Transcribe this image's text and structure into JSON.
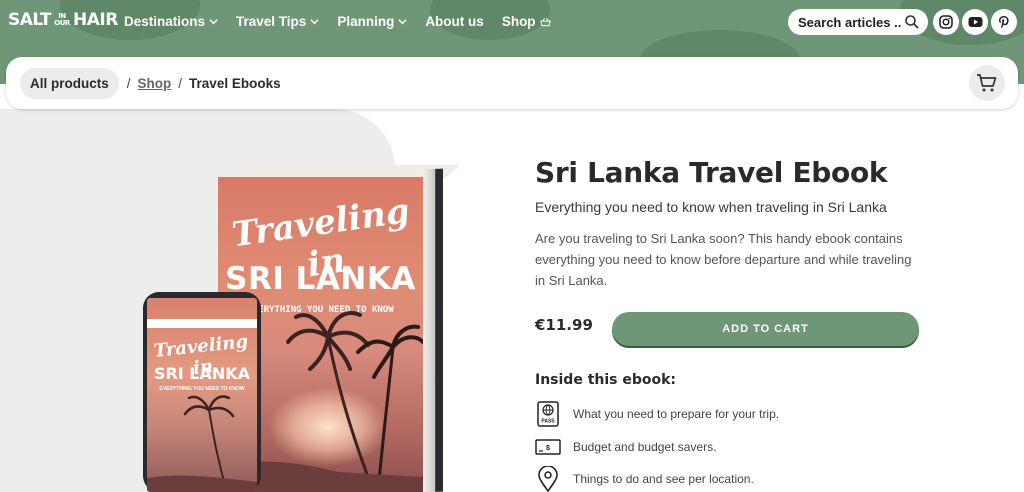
{
  "brand": {
    "logo_left": "SALT",
    "logo_small": "IN OUR",
    "logo_right": "HAIR"
  },
  "nav": {
    "items": [
      {
        "label": "Destinations",
        "dropdown": true
      },
      {
        "label": "Travel Tips",
        "dropdown": true
      },
      {
        "label": "Planning",
        "dropdown": true
      },
      {
        "label": "About us",
        "dropdown": false
      },
      {
        "label": "Shop",
        "dropdown": false,
        "icon": "basket-icon"
      }
    ]
  },
  "search": {
    "placeholder": "Search articles ...",
    "icon": "search-icon"
  },
  "social": [
    "instagram-icon",
    "youtube-icon",
    "pinterest-icon"
  ],
  "breadcrumb": {
    "all_products": "All products",
    "separator": "/",
    "shop": "Shop",
    "current": "Travel Ebooks"
  },
  "book": {
    "title_script": "Traveling in",
    "title_main": "SRI LANKA",
    "subtitle": "EVERYTHING YOU NEED TO KNOW"
  },
  "product": {
    "title": "Sri Lanka Travel Ebook",
    "subtitle": "Everything you need to know when traveling in Sri Lanka",
    "description": "Are you traveling to Sri Lanka soon? This handy ebook contains everything you need to know before departure and while traveling in Sri Lanka.",
    "price": "€11.99",
    "add_to_cart": "ADD TO CART",
    "inside_heading": "Inside this ebook:",
    "features": [
      {
        "icon": "passport-icon",
        "text": "What you need to prepare for your trip."
      },
      {
        "icon": "money-icon",
        "text": "Budget and budget savers."
      },
      {
        "icon": "map-pin-icon",
        "text": "Things to do and see per location."
      }
    ]
  },
  "colors": {
    "brand_green": "#6f9777",
    "dark_text": "#2a2a2a",
    "cover_coral": "#d97a68"
  }
}
